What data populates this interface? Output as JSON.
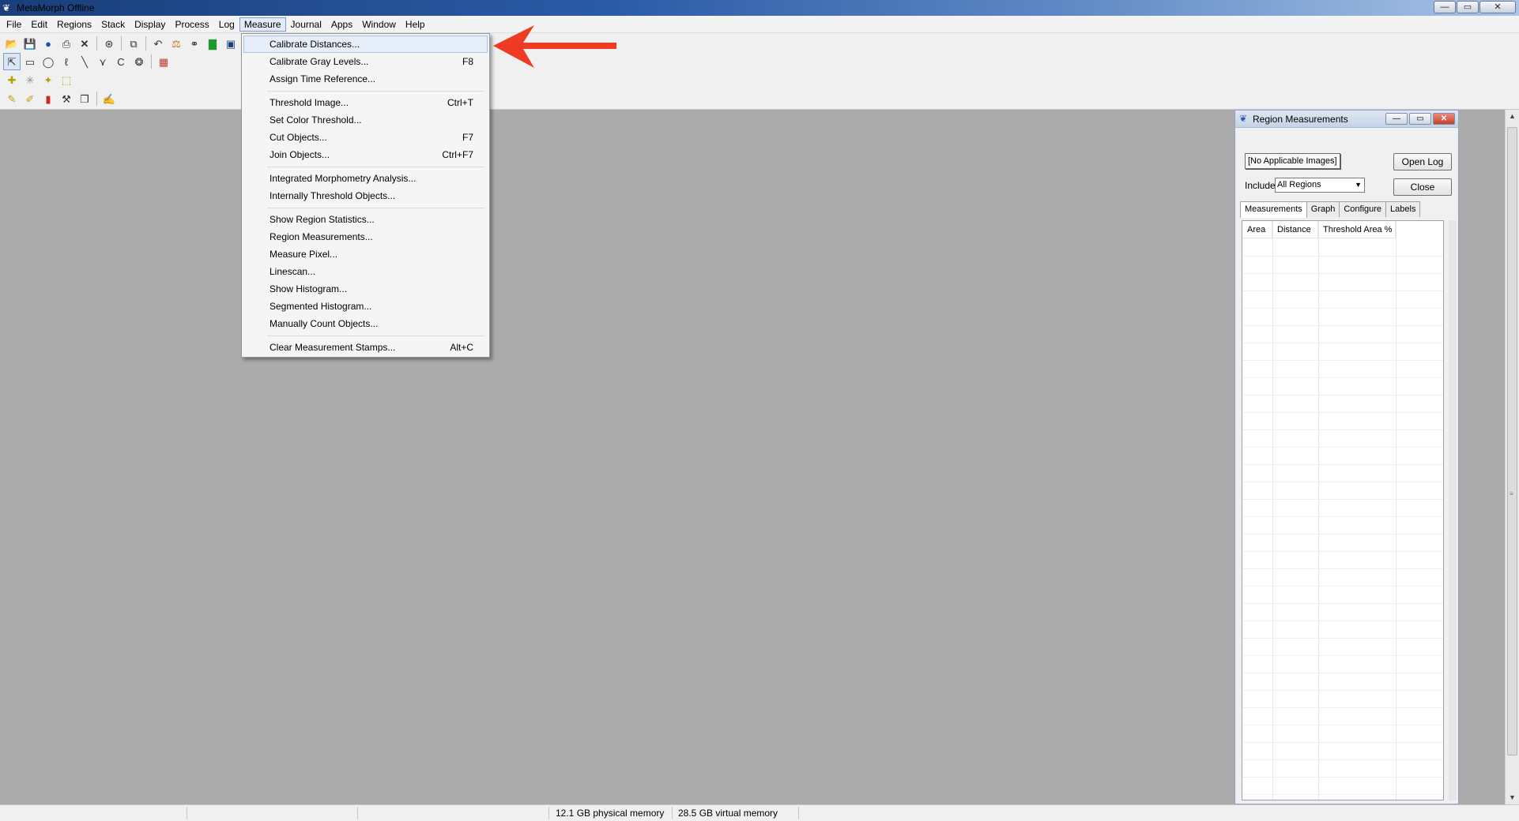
{
  "window": {
    "title": "MetaMorph Offline",
    "app_icon": "metamorph-butterfly-icon",
    "controls": {
      "minimize": "—",
      "restore": "▭",
      "close": "✕"
    }
  },
  "menubar": {
    "items": [
      "File",
      "Edit",
      "Regions",
      "Stack",
      "Display",
      "Process",
      "Log",
      "Measure",
      "Journal",
      "Apps",
      "Window",
      "Help"
    ],
    "active": "Measure"
  },
  "toolbar": {
    "row1": [
      "open-icon",
      "save-icon",
      "acquire-icon",
      "print-icon",
      "close-x-icon",
      "reset-icon",
      "copy-image-icon",
      "undo-icon",
      "scale-icon",
      "binoculars-icon",
      "histogram-icon",
      "monitor-icon"
    ],
    "row2": [
      "arrow-select-icon",
      "rectangle-region-icon",
      "ellipse-region-icon",
      "freehand-region-icon",
      "line-region-icon",
      "multiline-region-icon",
      "curve-region-icon",
      "autotrace-icon",
      "region-tools-icon"
    ],
    "row3": [
      "region-plus-icon",
      "region-star-icon",
      "region-magic-icon",
      "region-transfer-icon"
    ],
    "row4": [
      "pencil-icon",
      "pencil-edit-icon",
      "eraser-icon",
      "tools-icon",
      "copy-regions-icon",
      "annotate-icon"
    ]
  },
  "measure_menu": {
    "groups": [
      [
        {
          "label": "Calibrate Distances...",
          "shortcut": ""
        },
        {
          "label": "Calibrate Gray Levels...",
          "shortcut": "F8"
        },
        {
          "label": "Assign Time Reference...",
          "shortcut": ""
        }
      ],
      [
        {
          "label": "Threshold Image...",
          "shortcut": "Ctrl+T"
        },
        {
          "label": "Set Color Threshold...",
          "shortcut": ""
        },
        {
          "label": "Cut Objects...",
          "shortcut": "F7"
        },
        {
          "label": "Join Objects...",
          "shortcut": "Ctrl+F7"
        }
      ],
      [
        {
          "label": "Integrated Morphometry Analysis...",
          "shortcut": ""
        },
        {
          "label": "Internally Threshold Objects...",
          "shortcut": ""
        }
      ],
      [
        {
          "label": "Show Region Statistics...",
          "shortcut": ""
        },
        {
          "label": "Region Measurements...",
          "shortcut": ""
        },
        {
          "label": "Measure Pixel...",
          "shortcut": ""
        },
        {
          "label": "Linescan...",
          "shortcut": ""
        },
        {
          "label": "Show Histogram...",
          "shortcut": ""
        },
        {
          "label": "Segmented Histogram...",
          "shortcut": ""
        },
        {
          "label": "Manually Count Objects...",
          "shortcut": ""
        }
      ],
      [
        {
          "label": "Clear Measurement Stamps...",
          "shortcut": "Alt+C"
        }
      ]
    ],
    "highlighted": "Calibrate Distances..."
  },
  "annotation": {
    "arrow_color": "#ee3b24"
  },
  "region_dialog": {
    "title": "Region Measurements",
    "image_button": "[No Applicable Images]",
    "open_log": "Open Log",
    "include_label": "Include",
    "include_value": "All Regions",
    "close": "Close",
    "tabs": [
      "Measurements",
      "Graph",
      "Configure",
      "Labels"
    ],
    "active_tab": "Measurements",
    "columns": [
      "Area",
      "Distance",
      "Threshold Area %"
    ]
  },
  "statusbar": {
    "physical_memory": "12.1 GB physical memory",
    "virtual_memory": "28.5 GB virtual memory"
  },
  "colors": {
    "workspace": "#ababab",
    "menu_highlight": "#e5eef9",
    "accent_border": "#7a9cd1"
  }
}
